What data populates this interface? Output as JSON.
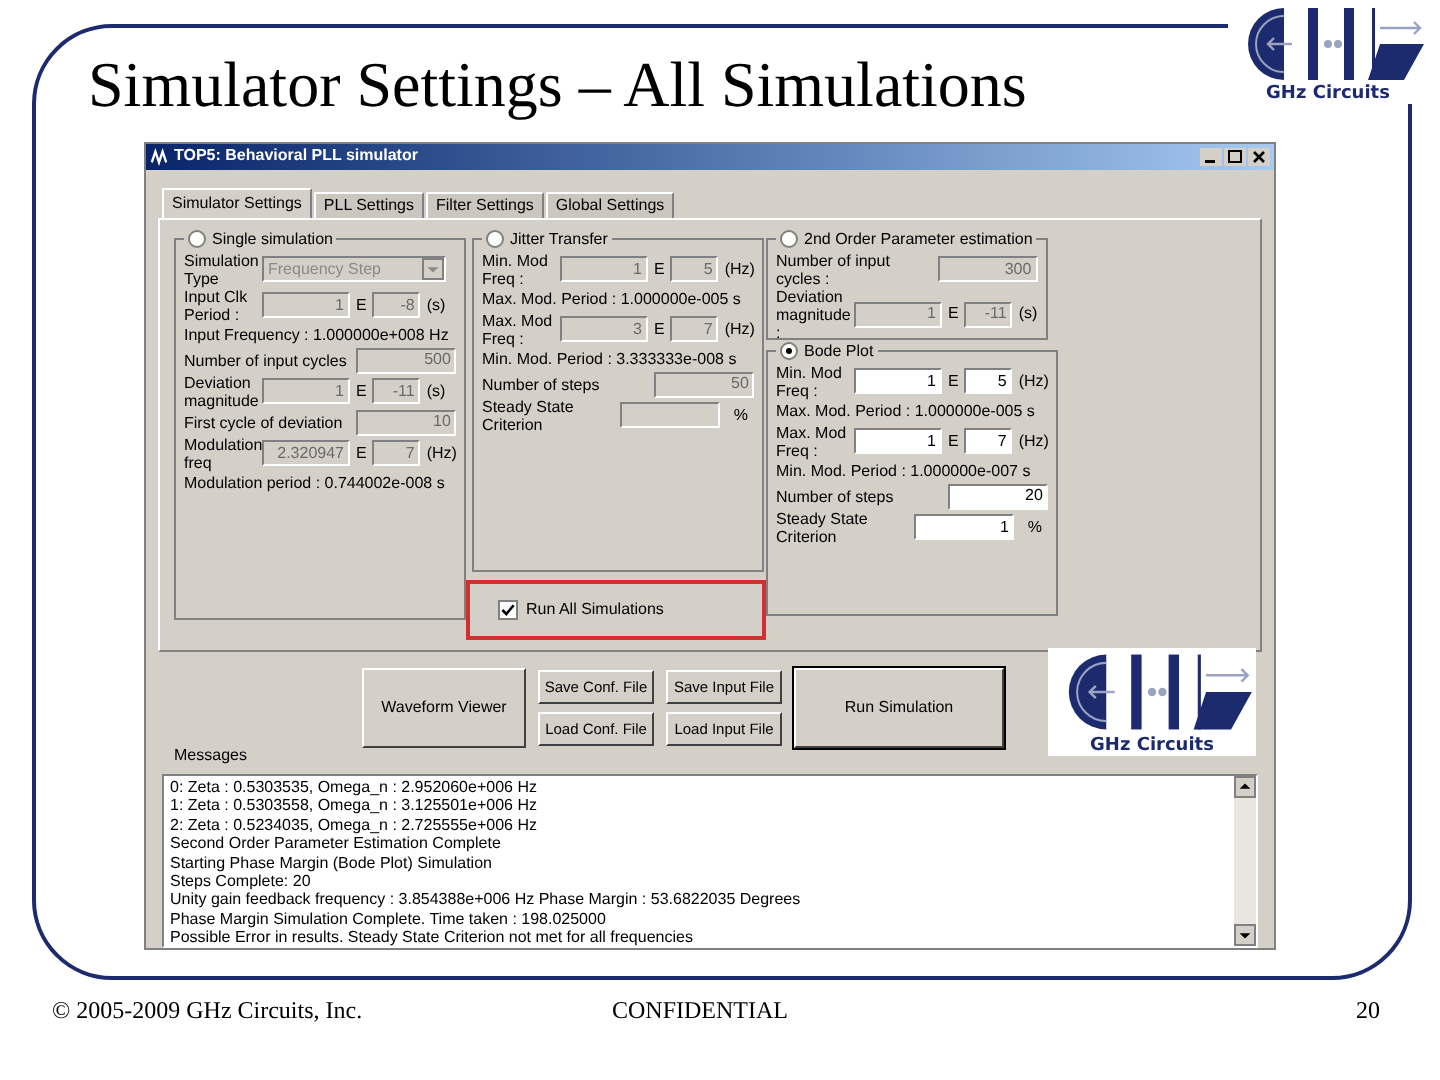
{
  "slide": {
    "title": "Simulator Settings – All Simulations",
    "footer": {
      "copyright": "© 2005-2009 GHz Circuits, Inc.",
      "confidential": "CONFIDENTIAL",
      "page": "20"
    }
  },
  "header_logo": {
    "caption": "GHz Circuits"
  },
  "window": {
    "title": "TOP5: Behavioral PLL simulator",
    "tabs": [
      {
        "label": "Simulator Settings",
        "selected": true
      },
      {
        "label": "PLL Settings",
        "selected": false
      },
      {
        "label": "Filter Settings",
        "selected": false
      },
      {
        "label": "Global Settings",
        "selected": false
      }
    ],
    "columns": [
      {
        "groups": [
          {
            "label": "Single simulation",
            "selected": false,
            "disabled": true,
            "rows": [
              {
                "kind": "select",
                "label": "Simulation Type",
                "value": "Frequency Step"
              },
              {
                "kind": "exp",
                "label": "Input Clk Period :",
                "mantissa": "1",
                "sep": "E",
                "exponent": "-8",
                "unit": "(s)"
              },
              {
                "kind": "text",
                "label": "Input Frequency : 1.000000e+008 Hz"
              },
              {
                "kind": "field",
                "label": "Number of input cycles",
                "value": "500"
              },
              {
                "kind": "exp",
                "label": "Deviation magnitude",
                "mantissa": "1",
                "sep": "E",
                "exponent": "-11",
                "unit": "(s)"
              },
              {
                "kind": "field",
                "label": "First cycle of deviation",
                "value": "10"
              },
              {
                "kind": "exp",
                "label": "Modulation freq",
                "mantissa": "2.320947",
                "sep": "E",
                "exponent": "7",
                "unit": "(Hz)"
              },
              {
                "kind": "text",
                "label": "Modulation period : 0.744002e-008 s"
              }
            ]
          }
        ]
      },
      {
        "groups": [
          {
            "label": "Jitter Transfer",
            "selected": false,
            "disabled": true,
            "rows": [
              {
                "kind": "exp",
                "label": "Min. Mod Freq :",
                "mantissa": "1",
                "sep": "E",
                "exponent": "5",
                "unit": "(Hz)"
              },
              {
                "kind": "text",
                "label": "Max. Mod. Period : 1.000000e-005 s"
              },
              {
                "kind": "exp",
                "label": "Max. Mod Freq :",
                "mantissa": "3",
                "sep": "E",
                "exponent": "7",
                "unit": "(Hz)"
              },
              {
                "kind": "text",
                "label": "Min. Mod. Period : 3.333333e-008 s"
              },
              {
                "kind": "field",
                "label": "Number of steps",
                "value": "50"
              },
              {
                "kind": "field",
                "label": "Steady State Criterion",
                "unit": "%"
              }
            ]
          }
        ]
      },
      {
        "groups": [
          {
            "label": "2nd Order Parameter estimation",
            "selected": false,
            "disabled": true,
            "rows": [
              {
                "kind": "field",
                "label": "Number of input cycles :",
                "value": "300"
              },
              {
                "kind": "exp",
                "label": "Deviation magnitude :",
                "mantissa": "1",
                "sep": "E",
                "exponent": "-11",
                "unit": "(s)"
              }
            ]
          },
          {
            "label": "Bode Plot",
            "selected": true,
            "disabled": false,
            "rows": [
              {
                "kind": "exp",
                "label": "Min. Mod Freq :",
                "mantissa": "1",
                "sep": "E",
                "exponent": "5",
                "unit": "(Hz)"
              },
              {
                "kind": "text",
                "label": "Max. Mod. Period : 1.000000e-005 s"
              },
              {
                "kind": "exp",
                "label": "Max. Mod Freq :",
                "mantissa": "1",
                "sep": "E",
                "exponent": "7",
                "unit": "(Hz)"
              },
              {
                "kind": "text",
                "label": "Min. Mod. Period : 1.000000e-007 s"
              },
              {
                "kind": "field",
                "label": "Number of steps",
                "value": "20"
              },
              {
                "kind": "field",
                "label": "Steady State Criterion",
                "value": "1",
                "unit": "%"
              }
            ]
          }
        ]
      }
    ],
    "run_all": {
      "label": "Run All Simulations",
      "checked": true
    },
    "buttons": {
      "waveform": "Waveform Viewer",
      "save_conf": "Save Conf. File",
      "load_conf": "Load Conf. File",
      "save_input": "Save Input File",
      "load_input": "Load Input File",
      "run": "Run Simulation"
    },
    "window_logo": {
      "caption": "GHz Circuits"
    },
    "messages": {
      "label": "Messages",
      "lines": [
        "0: Zeta : 0.5303535, Omega_n : 2.952060e+006 Hz",
        "1: Zeta : 0.5303558, Omega_n : 3.125501e+006 Hz",
        "2: Zeta : 0.5234035, Omega_n : 2.725555e+006 Hz",
        "Second Order Parameter Estimation Complete",
        "Starting Phase Margin (Bode Plot) Simulation",
        "Steps Complete: 20",
        "Unity gain feedback frequency : 3.854388e+006 Hz  Phase Margin : 53.6822035 Degrees",
        "Phase Margin Simulation Complete. Time taken : 198.025000",
        "Possible Error in results. Steady State Criterion not met for all frequencies"
      ]
    }
  }
}
